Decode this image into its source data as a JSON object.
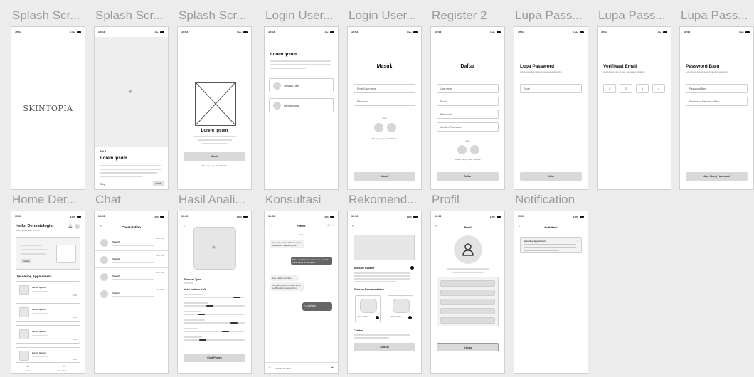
{
  "frames": [
    {
      "title": "Splash Scr...",
      "brand": "SKINTOPIA"
    },
    {
      "title": "Splash Scr...",
      "heading": "Lorem Ipsum",
      "skip": "Skip",
      "next": "Next"
    },
    {
      "title": "Splash Scr...",
      "heading": "Lorem Ipsum",
      "button": "Masuk",
      "footnote": "Belum punya akun? Daftar"
    },
    {
      "title": "Login User...",
      "heading": "Lorem Ipsum",
      "option1": "Sebagai User",
      "option2": "Dermatologist"
    },
    {
      "title": "Login User...",
      "heading": "Masuk",
      "field1": "Email/Username",
      "field2": "Password",
      "or": "atau",
      "footnote": "Belum punya akun? Daftar",
      "button": "Masuk"
    },
    {
      "title": "Register 2",
      "heading": "Daftar",
      "field1": "Username",
      "field2": "Email",
      "field3": "Password",
      "field4": "Confirm Password",
      "or": "atau",
      "footnote": "Sudah punya akun? Masuk",
      "button": "Daftar"
    },
    {
      "title": "Lupa Pass...",
      "heading": "Lupa Password",
      "sub": "Lorem ipsum dolor sit amet, consectetur adipiscing",
      "field1": "Email",
      "button": "Kirim"
    },
    {
      "title": "Lupa Pass...",
      "heading": "Verifikasi Email",
      "sub": "Lorem ipsum dolor sit amet, consectetur adipiscing",
      "d1": "0",
      "d2": "2",
      "d3": "3",
      "d4": "4"
    },
    {
      "title": "Lupa Pass...",
      "heading": "Password Baru",
      "sub": "Lorem ipsum dolor sit amet, consectetur adipiscing",
      "field1": "Password Baru",
      "field2": "Konfirmasi Password Baru",
      "button": "Atur Ulang Password"
    },
    {
      "title": "Home Der...",
      "heading": "Hello, Dermatologist",
      "sub": "Lorem ipsum dolor sit amet",
      "chip": "Explore",
      "section": "Upcoming Appoinment",
      "item": "Lorem Ipsum",
      "time1": "13.00",
      "time2": "14.00",
      "time3": "15.00",
      "time4": "16.00",
      "nav1": "Home",
      "nav2": "Konsultasi"
    },
    {
      "title": "Chat",
      "heading": "Consultation",
      "p1": "Patient1",
      "p2": "Patient2",
      "p3": "Patient3",
      "p4": "Patient4",
      "t": "12.12 PM"
    },
    {
      "title": "Hasil Anali...",
      "section1": "Skincare Type",
      "section2": "Hasil Analisis Kulit",
      "button": "Chat Pasien"
    },
    {
      "title": "Konsultasi",
      "heading": "Patient",
      "today": "Today",
      "m1": "Hi! Lorem ipsum dolor sit amet, consectetur adipiscing elit.",
      "m2": "Nisl a nec tincidunt cursus, et quis elit. Porta lacus eu sit mollis.",
      "m3": "Duis mauris vel vitae.",
      "m4": "Dui diam pretium fringilla enim eu. Bibendum arcu rutrum.",
      "input": "Write a comment..."
    },
    {
      "title": "Rekomend...",
      "section1": "Skincare Routine",
      "section2": "Skincare Recomendation",
      "prod1": "Product Name",
      "prod2": "Product Name",
      "section3": "Catatan",
      "button": "Selesai"
    },
    {
      "title": "Profil",
      "heading": "Profil",
      "button": "Keluar"
    },
    {
      "title": "Notification",
      "heading": "Notifikasi",
      "item": "Upcoming Appoinment"
    }
  ],
  "status": {
    "time": "19:03",
    "battery": "10%"
  }
}
